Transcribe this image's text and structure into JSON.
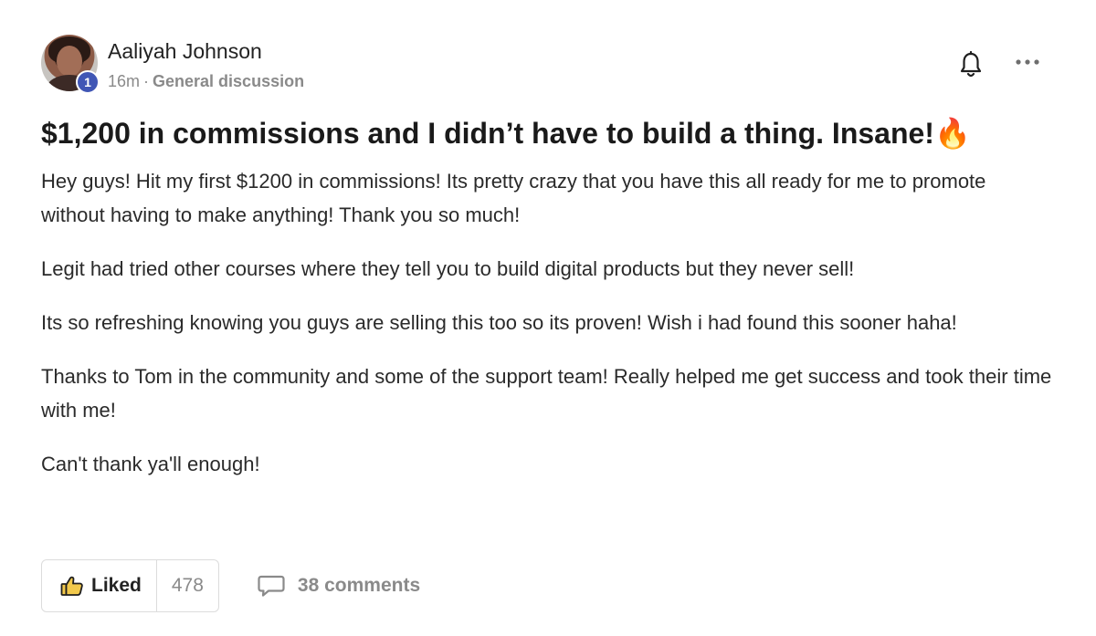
{
  "post": {
    "author": {
      "name": "Aaliyah Johnson",
      "level": "1"
    },
    "meta": {
      "time": "16m",
      "separator": "·",
      "category": "General discussion"
    },
    "title": "$1,200 in commissions and I didn’t have to build a thing. Insane!🔥",
    "paragraphs": [
      "Hey guys! Hit my first $1200 in commissions! Its pretty crazy that you have this all ready for me to promote without having to make anything! Thank you so much!",
      "Legit had tried other courses where they tell you to build digital products but they never sell!",
      "Its so refreshing knowing you guys are selling this too so its proven! Wish i had found this sooner haha!",
      "Thanks to Tom in the community and some of the support team! Really helped me get success and took their time with me!",
      "Can't thank ya'll enough!"
    ],
    "actions": {
      "like_label": "Liked",
      "like_count": "478",
      "comments_label": "38 comments"
    }
  },
  "icons": {
    "bell": "bell-icon",
    "more": "more-horizontal-icon",
    "like": "thumbs-up-icon",
    "comment": "comment-bubble-icon"
  }
}
